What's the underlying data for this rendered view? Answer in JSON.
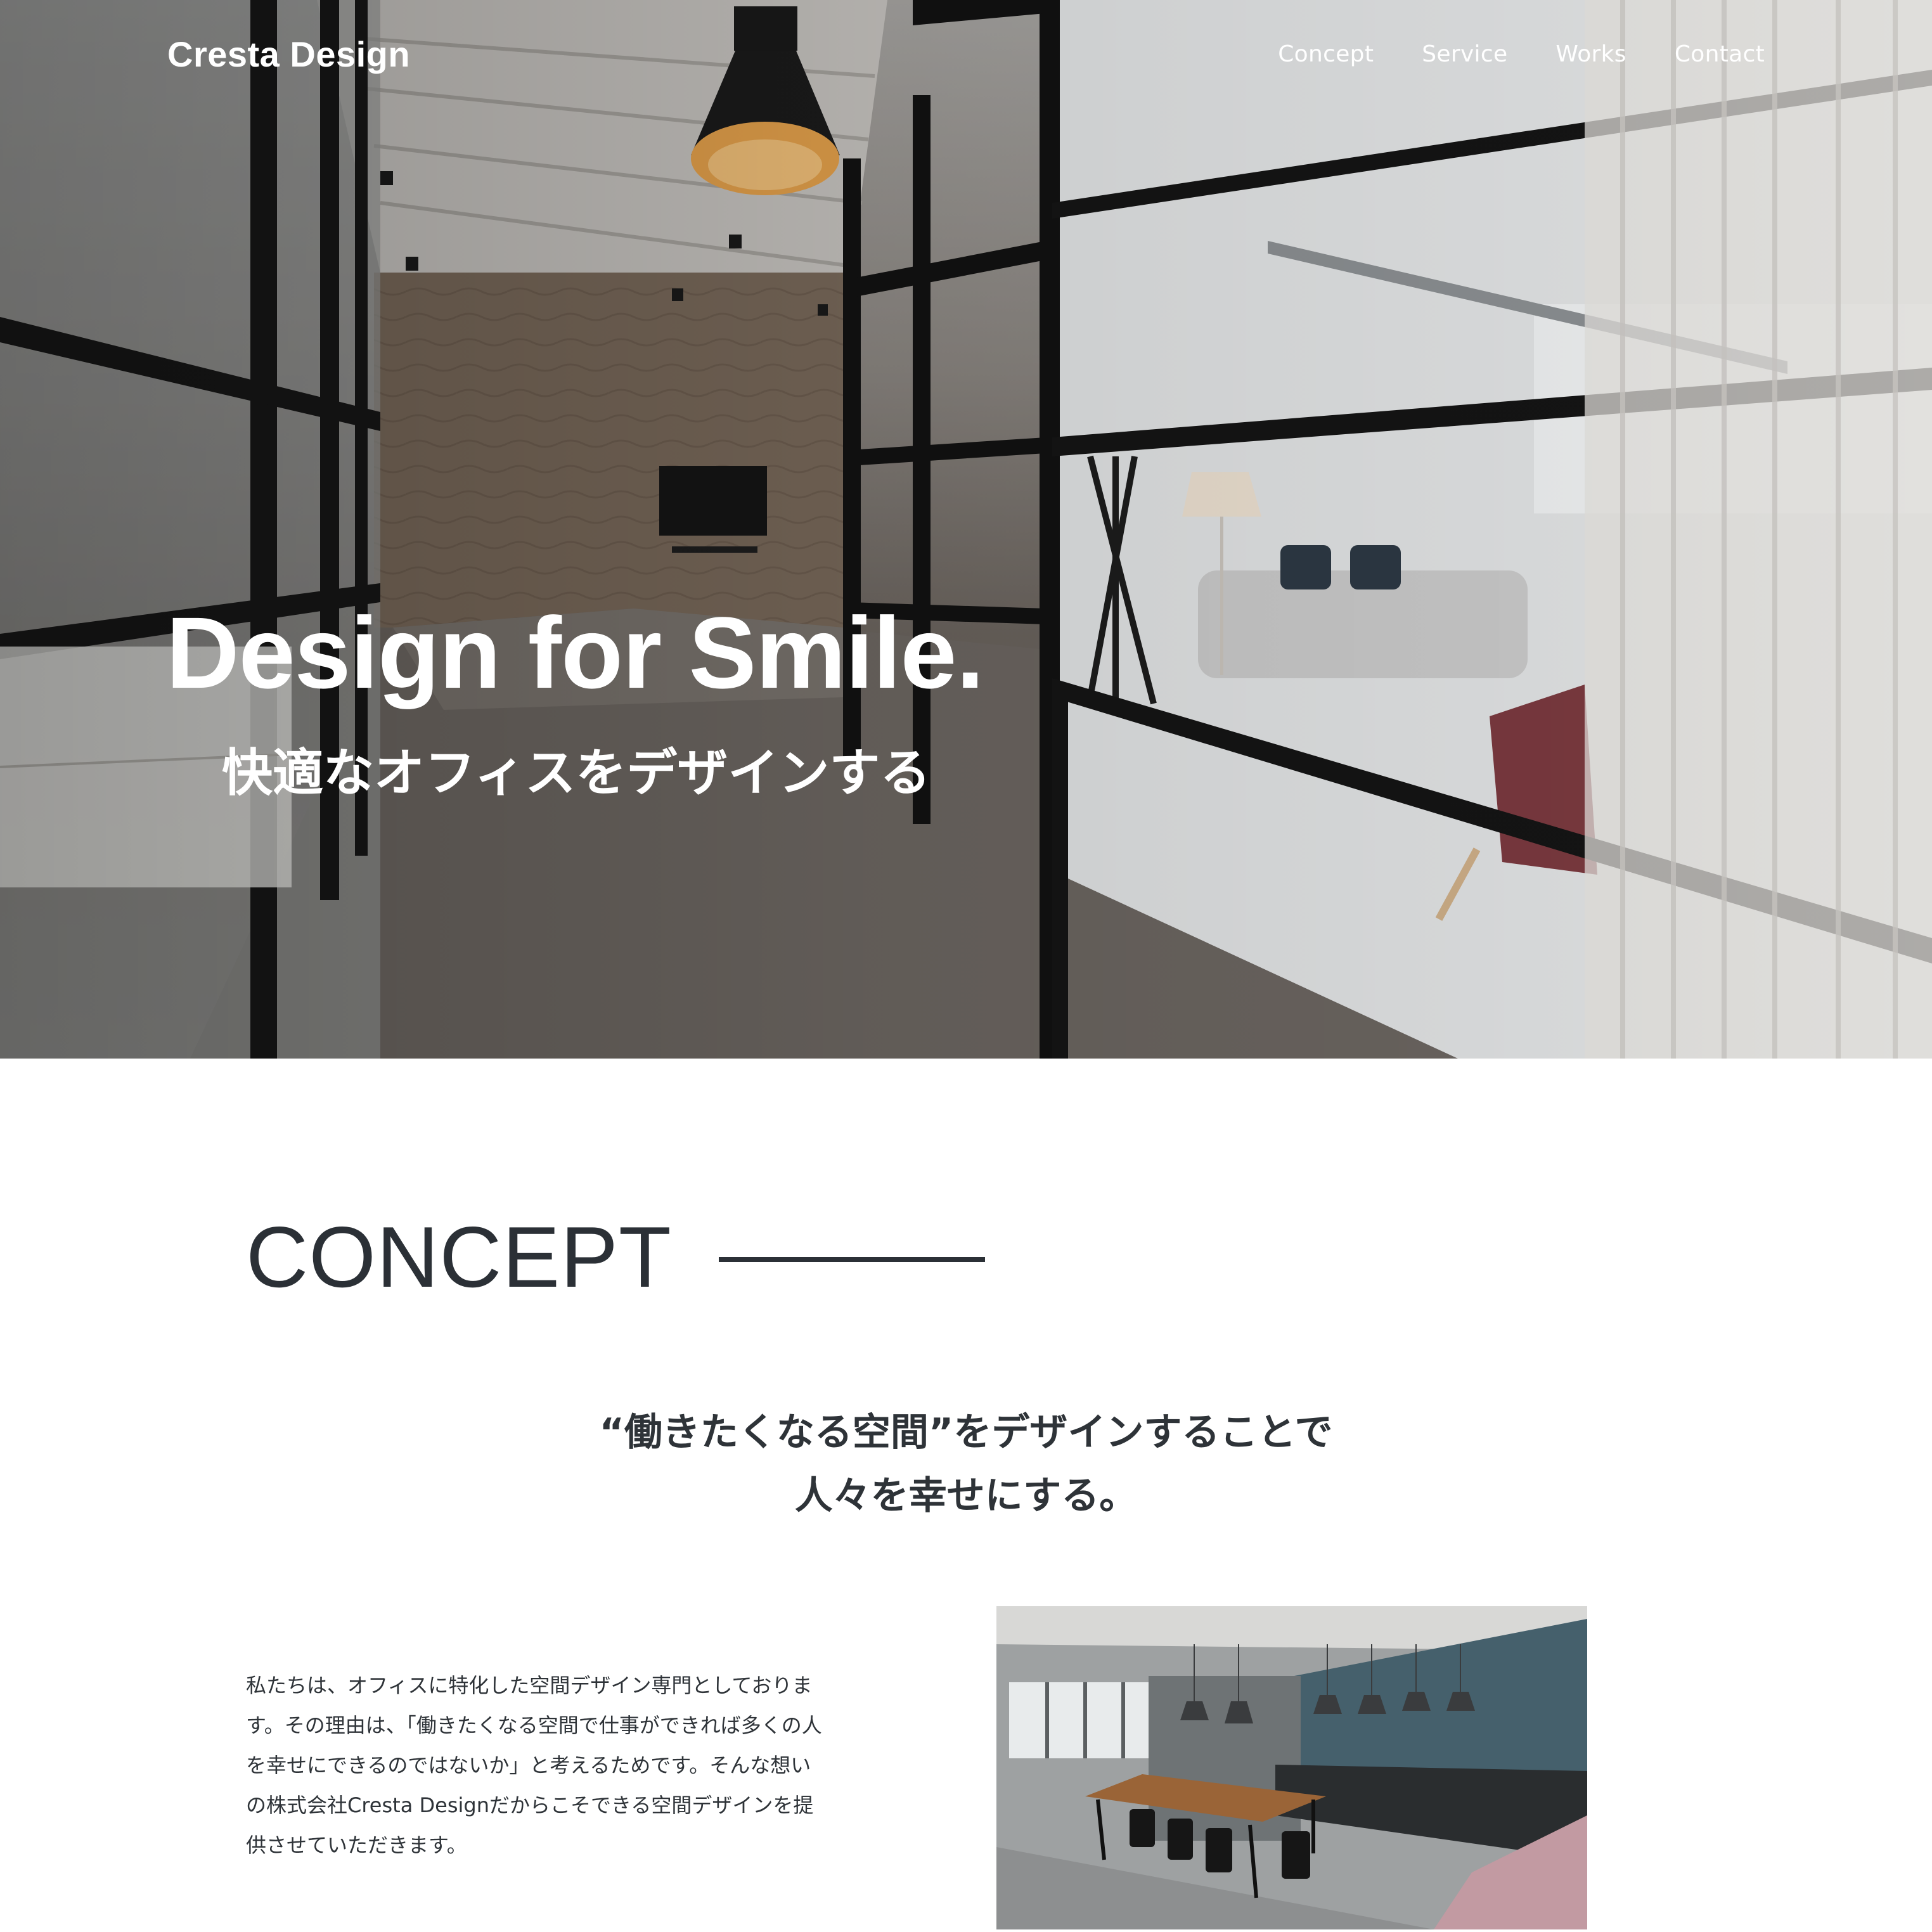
{
  "header": {
    "logo": "Cresta Design",
    "nav": [
      "Concept",
      "Service",
      "Works",
      "Contact"
    ]
  },
  "hero": {
    "title": "Design for Smile.",
    "subtitle": "快適なオフィスをデザインする",
    "image": "office-glass-partition-photo"
  },
  "concept": {
    "heading": "CONCEPT",
    "lead_line1": "“働きたくなる空間”をデザインすることで",
    "lead_line2": "人々を幸せにする。",
    "body": "私たちは、オフィスに特化した空間デザイン専門としております。その理由は、「働きたくなる空間で仕事ができれば多くの人を幸せにできるのではないか」と考えるためです。そんな想いの株式会社Cresta Designだからこそできる空間デザインを提供させていただきます。",
    "image": "dining-room-office-photo"
  },
  "colors": {
    "text": "#2b3036",
    "hero_text": "#ffffff",
    "background": "#ffffff"
  }
}
